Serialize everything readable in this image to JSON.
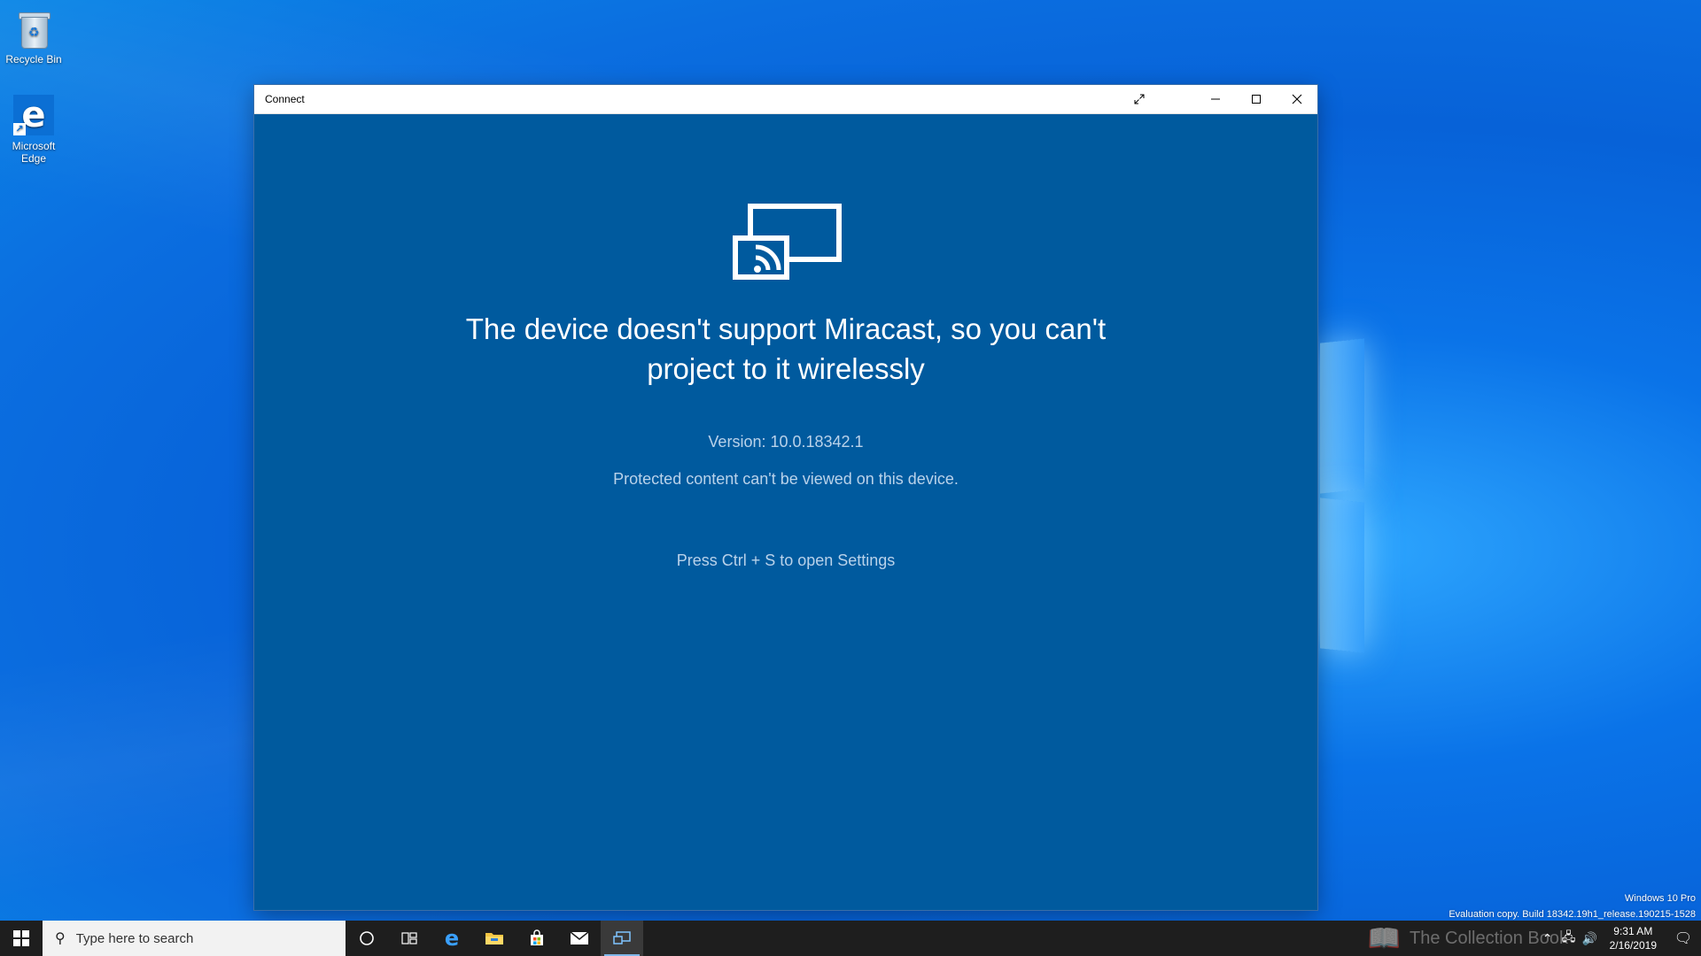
{
  "desktop": {
    "icons": [
      {
        "label": "Recycle Bin",
        "icon": "recycle-bin-icon"
      },
      {
        "label": "Microsoft Edge",
        "icon": "edge-icon"
      }
    ],
    "watermark": {
      "edition": "Windows 10 Pro",
      "build": "Evaluation copy. Build 18342.19h1_release.190215-1528"
    },
    "brand": "The Collection Book"
  },
  "window": {
    "title": "Connect",
    "controls": {
      "expand": "expand-icon",
      "minimize": "minimize-icon",
      "maximize": "maximize-icon",
      "close": "close-icon"
    },
    "background": "#005a9e",
    "message_line1": "The device doesn't support Miracast, so you can't",
    "message_line2": "project to it wirelessly",
    "version": "Version: 10.0.18342.1",
    "protected": "Protected content can't be viewed on this device.",
    "hint": "Press Ctrl + S to open Settings"
  },
  "taskbar": {
    "search_placeholder": "Type here to search",
    "pinned": [
      "cortana-icon",
      "task-view-icon",
      "edge-icon",
      "file-explorer-icon",
      "store-icon",
      "mail-icon",
      "connect-app-icon"
    ],
    "active": "connect-app-icon",
    "clock": {
      "time": "9:31 AM",
      "date": "2/16/2019"
    }
  }
}
